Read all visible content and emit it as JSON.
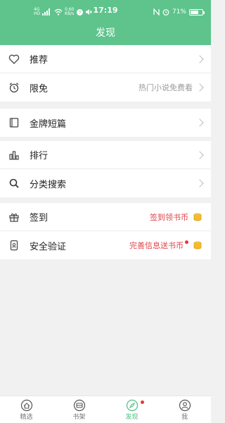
{
  "status_bar": {
    "network": "4G",
    "hd": "HD",
    "speed": "0.60",
    "speed_unit": "KB/s",
    "time": "17:19",
    "battery_text": "71%",
    "battery_level": 0.71
  },
  "header": {
    "title": "发现"
  },
  "colors": {
    "accent": "#5ec48c",
    "highlight_red": "#e0434b"
  },
  "groups": [
    {
      "items": [
        {
          "label": "推荐",
          "icon": "heart-icon",
          "right_text": "",
          "right_style": ""
        },
        {
          "label": "限免",
          "icon": "alarm-clock-icon",
          "right_text": "热门小说免费看",
          "right_style": "gray"
        }
      ]
    },
    {
      "items": [
        {
          "label": "金牌短篇",
          "icon": "book-icon",
          "right_text": "",
          "right_style": ""
        }
      ]
    },
    {
      "items": [
        {
          "label": "排行",
          "icon": "bar-chart-icon",
          "right_text": "",
          "right_style": ""
        },
        {
          "label": "分类搜索",
          "icon": "search-icon",
          "right_text": "",
          "right_style": ""
        }
      ]
    },
    {
      "items": [
        {
          "label": "签到",
          "icon": "gift-icon",
          "right_text": "签到领书币",
          "right_style": "red"
        },
        {
          "label": "安全验证",
          "icon": "phone-icon",
          "right_text": "完善信息送书币",
          "right_style": "red"
        }
      ]
    }
  ],
  "tabbar": {
    "tabs": [
      {
        "label": "精选",
        "icon": "home-icon",
        "active": false
      },
      {
        "label": "书架",
        "icon": "bookshelf-icon",
        "active": false
      },
      {
        "label": "发现",
        "icon": "compass-icon",
        "active": true
      },
      {
        "label": "我",
        "icon": "user-icon",
        "active": false
      }
    ]
  }
}
